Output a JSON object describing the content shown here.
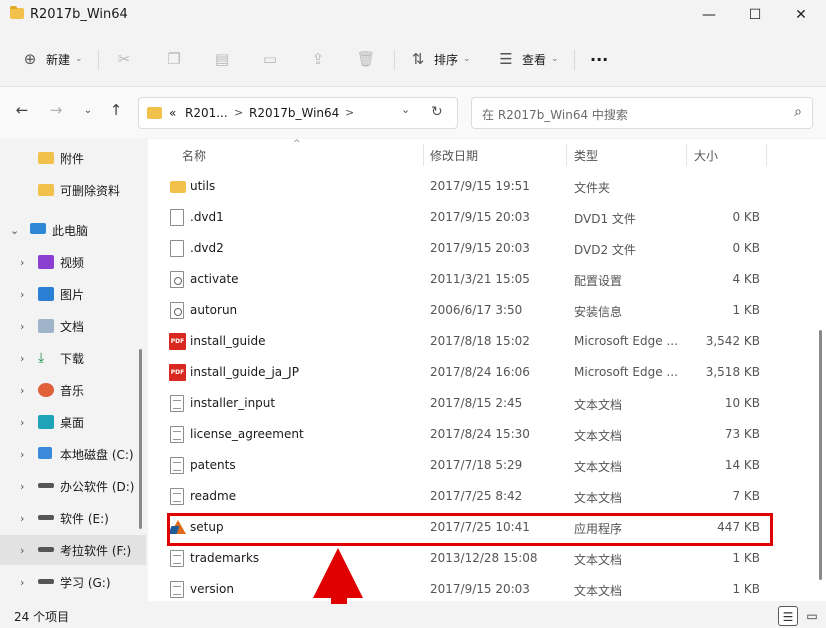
{
  "window": {
    "title": "R2017b_Win64",
    "minimize": "—",
    "maximize": "☐",
    "close": "✕"
  },
  "toolbar": {
    "new_label": "新建",
    "sort_label": "排序",
    "view_label": "查看",
    "more": "···"
  },
  "address": {
    "seg1": "«",
    "seg2": "R201...",
    "seg3": "R2017b_Win64",
    "chev": ">",
    "dropdown": "⌄",
    "refresh": "↻"
  },
  "search": {
    "placeholder": "在 R2017b_Win64 中搜索"
  },
  "sidebar": {
    "items": [
      {
        "label": "附件"
      },
      {
        "label": "可删除资料"
      },
      {
        "label": "此电脑"
      },
      {
        "label": "视频"
      },
      {
        "label": "图片"
      },
      {
        "label": "文档"
      },
      {
        "label": "下载"
      },
      {
        "label": "音乐"
      },
      {
        "label": "桌面"
      },
      {
        "label": "本地磁盘 (C:)"
      },
      {
        "label": "办公软件 (D:)"
      },
      {
        "label": "软件 (E:)"
      },
      {
        "label": "考拉软件 (F:)"
      },
      {
        "label": "学习 (G:)"
      }
    ]
  },
  "columns": {
    "name": "名称",
    "date": "修改日期",
    "type": "类型",
    "size": "大小"
  },
  "files": [
    {
      "name": "utils",
      "date": "2017/9/15 19:51",
      "type": "文件夹",
      "size": "",
      "icon": "folder-icon"
    },
    {
      "name": ".dvd1",
      "date": "2017/9/15 20:03",
      "type": "DVD1 文件",
      "size": "0 KB",
      "icon": "file-icon"
    },
    {
      "name": ".dvd2",
      "date": "2017/9/15 20:03",
      "type": "DVD2 文件",
      "size": "0 KB",
      "icon": "file-icon"
    },
    {
      "name": "activate",
      "date": "2011/3/21 15:05",
      "type": "配置设置",
      "size": "4 KB",
      "icon": "config-icon"
    },
    {
      "name": "autorun",
      "date": "2006/6/17 3:50",
      "type": "安装信息",
      "size": "1 KB",
      "icon": "config-icon"
    },
    {
      "name": "install_guide",
      "date": "2017/8/18 15:02",
      "type": "Microsoft Edge ...",
      "size": "3,542 KB",
      "icon": "pdf-icon"
    },
    {
      "name": "install_guide_ja_JP",
      "date": "2017/8/24 16:06",
      "type": "Microsoft Edge ...",
      "size": "3,518 KB",
      "icon": "pdf-icon"
    },
    {
      "name": "installer_input",
      "date": "2017/8/15 2:45",
      "type": "文本文档",
      "size": "10 KB",
      "icon": "text-file-icon"
    },
    {
      "name": "license_agreement",
      "date": "2017/8/24 15:30",
      "type": "文本文档",
      "size": "73 KB",
      "icon": "text-file-icon"
    },
    {
      "name": "patents",
      "date": "2017/7/18 5:29",
      "type": "文本文档",
      "size": "14 KB",
      "icon": "text-file-icon"
    },
    {
      "name": "readme",
      "date": "2017/7/25 8:42",
      "type": "文本文档",
      "size": "7 KB",
      "icon": "text-file-icon"
    },
    {
      "name": "setup",
      "date": "2017/7/25 10:41",
      "type": "应用程序",
      "size": "447 KB",
      "icon": "matlab-icon"
    },
    {
      "name": "trademarks",
      "date": "2013/12/28 15:08",
      "type": "文本文档",
      "size": "1 KB",
      "icon": "text-file-icon"
    },
    {
      "name": "version",
      "date": "2017/9/15 20:03",
      "type": "文本文档",
      "size": "1 KB",
      "icon": "text-file-icon"
    }
  ],
  "status": {
    "count": "24 个项目"
  },
  "colors": {
    "highlight": "#e00000",
    "folder": "#f1c14b"
  }
}
